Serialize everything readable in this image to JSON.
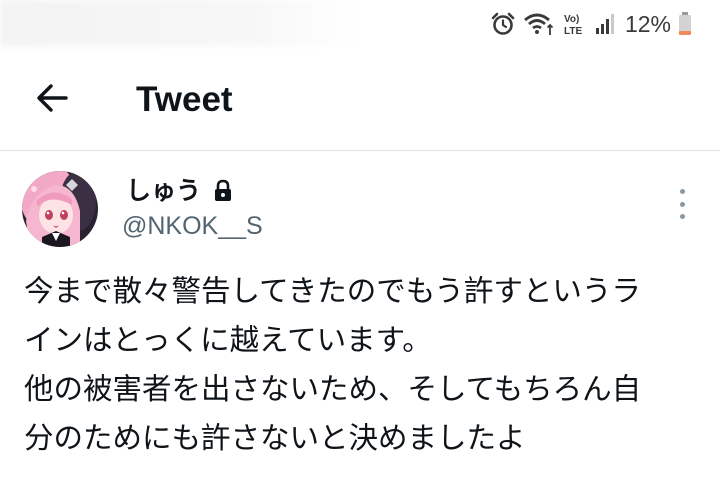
{
  "status_bar": {
    "battery_percent": "12%",
    "network_label": "Vo) LTE",
    "icons": [
      "alarm-icon",
      "wifi-icon",
      "volte-lte-icon",
      "signal-icon",
      "battery-icon"
    ],
    "battery_color": "#f08a5d"
  },
  "header": {
    "back_icon": "arrow-left-icon",
    "title": "Tweet"
  },
  "tweet": {
    "author": {
      "display_name": "しゅう",
      "handle": "@NKOK__S",
      "protected": true
    },
    "text_lines": [
      "今まで散々警告してきたのでもう許すというラ",
      "インはとっくに越えています。",
      "他の被害者を出さないため、そしてもちろん自",
      "分のためにも許さないと決めましたよ"
    ]
  },
  "colors": {
    "text_primary": "#0f1419",
    "text_secondary": "#536471",
    "divider": "#dfe3e6"
  }
}
